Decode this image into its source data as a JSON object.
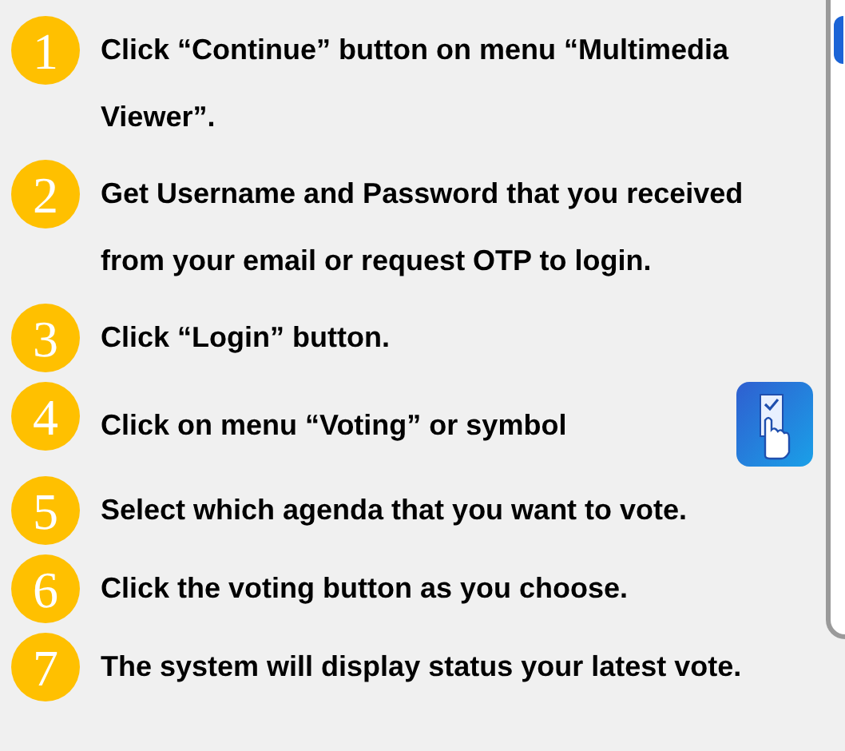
{
  "steps": [
    {
      "number": "1",
      "kind": "plain",
      "text": "Click “Continue” button on menu “Multimedia Viewer”."
    },
    {
      "number": "2",
      "kind": "plain",
      "text": "Get Username and Password that you received from your email or request OTP to login."
    },
    {
      "number": "3",
      "kind": "plain",
      "text": "Click “Login” button."
    },
    {
      "number": "4",
      "kind": "with_symbol",
      "text": "Click on menu “Voting” or symbol"
    },
    {
      "number": "5",
      "kind": "plain",
      "text": "Select which agenda that you want to vote."
    },
    {
      "number": "6",
      "kind": "plain",
      "text": "Click the voting button as you choose."
    },
    {
      "number": "7",
      "kind": "plain",
      "text": "The system will display status your latest vote."
    }
  ]
}
